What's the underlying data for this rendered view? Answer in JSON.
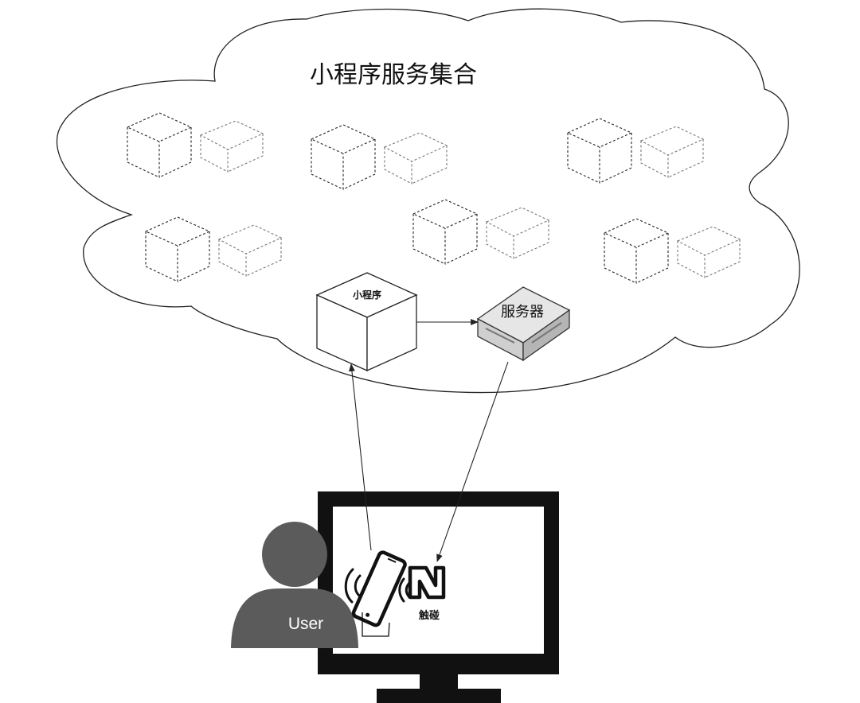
{
  "cloud": {
    "title": "小程序服务集合"
  },
  "mini_program": {
    "label": "小程序"
  },
  "server": {
    "label": "服务器"
  },
  "user": {
    "label": "User"
  },
  "nfc": {
    "label": "触碰"
  },
  "icons": [
    "nfc-icon",
    "phone-icon",
    "user-icon",
    "monitor-icon",
    "server-icon"
  ]
}
